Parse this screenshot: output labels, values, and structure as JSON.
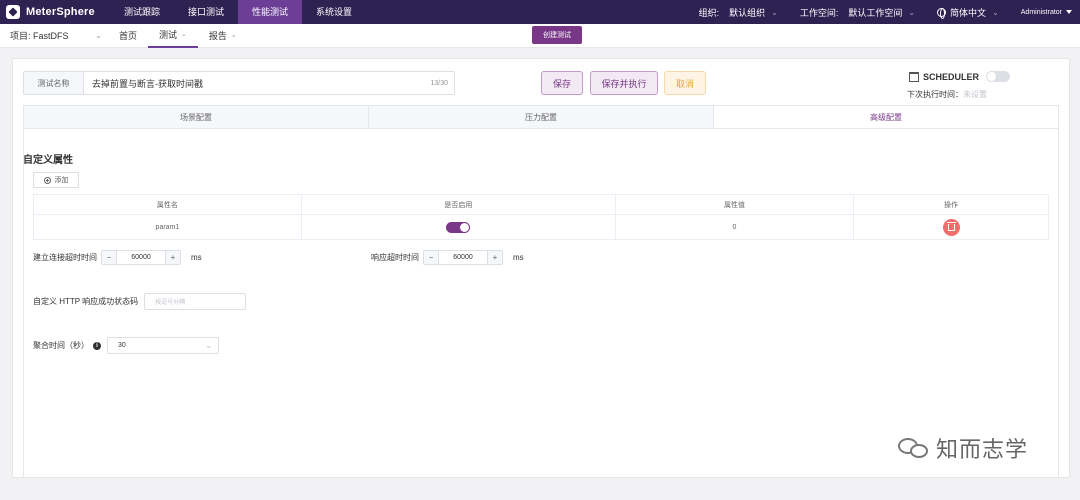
{
  "header": {
    "brand": "MeterSphere",
    "nav": [
      "测试跟踪",
      "接口测试",
      "性能测试",
      "系统设置"
    ],
    "org_label": "组织:",
    "org_value": "默认组织",
    "workspace_label": "工作空间:",
    "workspace_value": "默认工作空间",
    "language": "简体中文",
    "user": "Administrator"
  },
  "subnav": {
    "project": "项目: FastDFS",
    "items": [
      "首页",
      "测试",
      "报告"
    ],
    "create_button": "创建测试"
  },
  "test": {
    "name_label": "测试名称",
    "name_value": "去掉前置与断言-获取时间戳",
    "name_count": "13/30",
    "save": "保存",
    "save_run": "保存并执行",
    "cancel": "取消",
    "scheduler_label": "SCHEDULER",
    "next_run_label": "下次执行时间：",
    "next_run_value": "未设置"
  },
  "tabs": [
    "场景配置",
    "压力配置",
    "高级配置"
  ],
  "advanced": {
    "section_title": "自定义属性",
    "add_label": "添加",
    "table": {
      "headers": [
        "属性名",
        "是否启用",
        "属性值",
        "操作"
      ],
      "rows": [
        {
          "name": "param1",
          "enabled": true,
          "value": "0"
        }
      ]
    },
    "connect_timeout_label": "建立连接超时时间",
    "connect_timeout_value": "60000",
    "response_timeout_label": "响应超时时间",
    "response_timeout_value": "60000",
    "unit": "ms",
    "http_code_label": "自定义 HTTP 响应成功状态码",
    "http_code_placeholder": "按逗号分隔",
    "granularity_label": "聚合时间（秒）",
    "granularity_value": "30"
  },
  "watermark": "知而志学",
  "colors": {
    "header_bg": "#2d2252",
    "accent": "#783887",
    "danger": "#f56c6c",
    "warning": "#e6a23c"
  }
}
